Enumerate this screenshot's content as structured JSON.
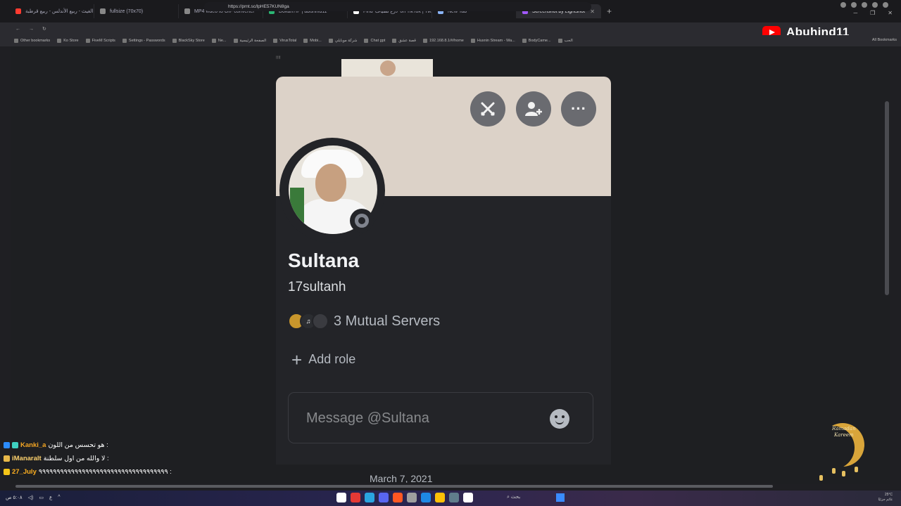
{
  "browser": {
    "tabs": [
      {
        "label": "جادك الغيث - ربيع الأندلس - ربيع قرطبة",
        "color": "#ff3b30"
      },
      {
        "label": "fullsize (70x70)",
        "color": "#888888"
      },
      {
        "label": "MP4 video to GIF converter",
        "color": "#888888"
      },
      {
        "label": "Dokan7IP | abuhind11",
        "color": "#2bb673"
      },
      {
        "label": "Find 'درع تضياف' on TikTok | TikTok Se",
        "color": "#ffffff"
      },
      {
        "label": "New Tab",
        "color": "#8ab4f8"
      },
      {
        "label": "Screenshot by Lightshot",
        "color": "#a259ff",
        "active": true
      }
    ],
    "url": "https://prnt.sc/lpHE57KUN8ga",
    "bookmarks": [
      "Other bookmarks",
      "Ko Store",
      "FiveM Scripts",
      "Settings - Passwords",
      "BlackSky Store",
      "Ne...",
      "الصفحة الرئيسية",
      "VirusTotal",
      "Mobi...",
      "شركة موبايلي",
      "Chat gpt",
      "قصة عشق",
      "192.168.8.1/#/home",
      "Husnin Stream - Wa...",
      "BodyCame...",
      "الحب"
    ],
    "all_bookmarks": "All Bookmarks"
  },
  "overlay": {
    "channel_name": "Abuhind11",
    "chat": [
      {
        "user": "Kanki_a",
        "message": "هو تحسس من اللون :",
        "color": "#f5a623"
      },
      {
        "user": "iManaralt",
        "message": "لا والله من اول سلطنة :",
        "color": "#ffd36e"
      },
      {
        "user": "27_July",
        "message": "٩٩٩٩٩٩٩٩٩٩٩٩٩٩٩٩٩٩٩٩٩٩٩٩٩٩٩٩٩٩٩٩٩٩٩٩ :",
        "color": "#ffb020"
      }
    ],
    "ramadan_line1": "Ramadan",
    "ramadan_line2": "Kareem"
  },
  "profile": {
    "peek_label": "!!!!",
    "display_name": "Sultana",
    "username": "17sultanh",
    "mutual_servers_label": "3 Mutual Servers",
    "add_role_label": "Add role",
    "message_placeholder": "Message @Sultana",
    "footer_cut_text": "March 7, 2021",
    "buttons": [
      "duel-icon",
      "add-friend-icon",
      "more-icon"
    ],
    "server_icon_colors": [
      "#c8962c",
      "#2b2d31",
      "#3a3b40"
    ],
    "banner_color": "#dcd2c8"
  },
  "taskbar": {
    "search_label": "بحث",
    "weather_temp": "25°C",
    "weather_desc": "غائم جزئيًا",
    "time": "٥:٠٨ ص",
    "date": "٢٧/٠٣/٢٥"
  }
}
